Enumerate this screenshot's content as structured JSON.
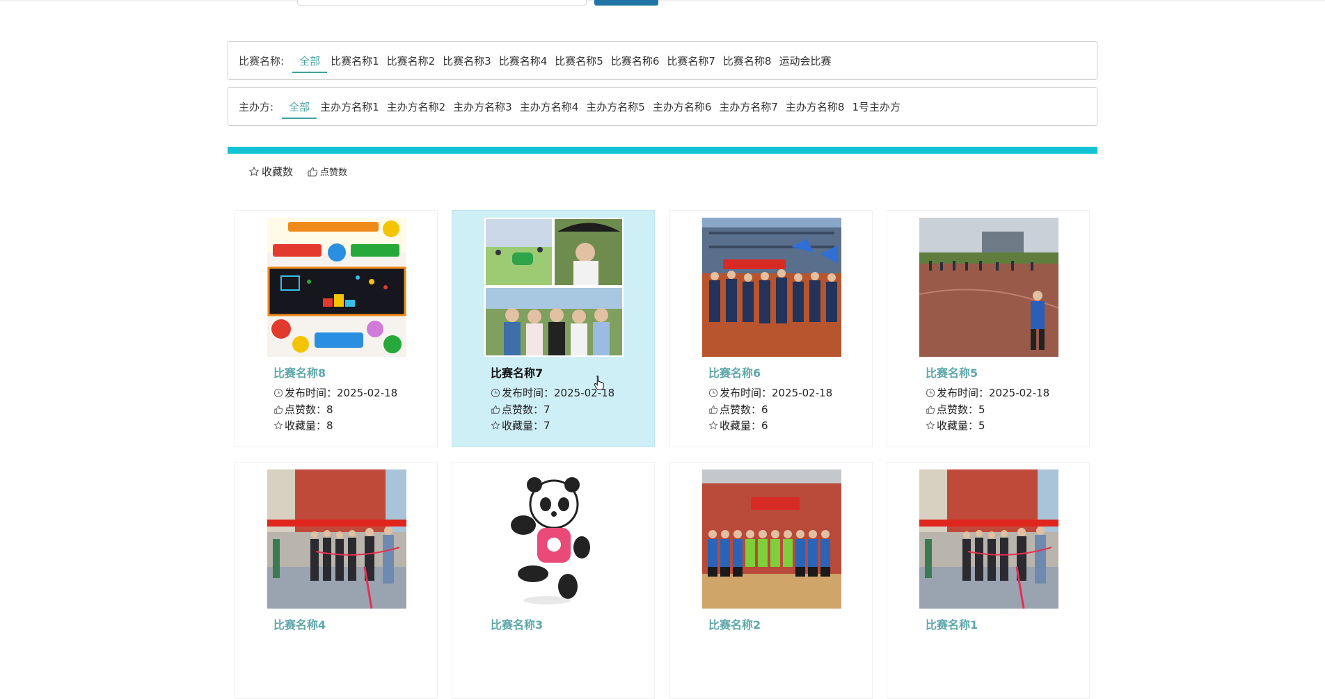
{
  "filters": {
    "match_label": "比赛名称:",
    "match_options": [
      "全部",
      "比赛名称1",
      "比赛名称2",
      "比赛名称3",
      "比赛名称4",
      "比赛名称5",
      "比赛名称6",
      "比赛名称7",
      "比赛名称8",
      "运动会比赛"
    ],
    "organizer_label": "主办方:",
    "organizer_options": [
      "全部",
      "主办方名称1",
      "主办方名称2",
      "主办方名称3",
      "主办方名称4",
      "主办方名称5",
      "主办方名称6",
      "主办方名称7",
      "主办方名称8",
      "1号主办方"
    ]
  },
  "sort": {
    "favorites_label": "收藏数",
    "likes_label": "点赞数"
  },
  "labels": {
    "publish_time": "发布时间：",
    "likes": "点赞数：",
    "favorites": "收藏量："
  },
  "colors": {
    "accent_bar": "#11c3d4",
    "active_filter": "#4aa3a3",
    "highlight_card": "#cfeff7",
    "title_teal": "#5ea7aa"
  },
  "cards": [
    {
      "title": "比赛名称8",
      "date": "2025-02-18",
      "likes": "8",
      "favorites": "8",
      "image": "sports-poster-image"
    },
    {
      "title": "比赛名称7",
      "date": "2025-02-18",
      "likes": "7",
      "favorites": "7",
      "image": "photo-collage-image"
    },
    {
      "title": "比赛名称6",
      "date": "2025-02-18",
      "likes": "6",
      "favorites": "6",
      "image": "parade-image"
    },
    {
      "title": "比赛名称5",
      "date": "2025-02-18",
      "likes": "5",
      "favorites": "5",
      "image": "running-track-image"
    },
    {
      "title": "比赛名称4",
      "image": "ribbon-ceremony-image"
    },
    {
      "title": "比赛名称3",
      "image": "panda-mascot-image"
    },
    {
      "title": "比赛名称2",
      "image": "team-photo-image"
    },
    {
      "title": "比赛名称1",
      "image": "ribbon-ceremony-image"
    }
  ]
}
